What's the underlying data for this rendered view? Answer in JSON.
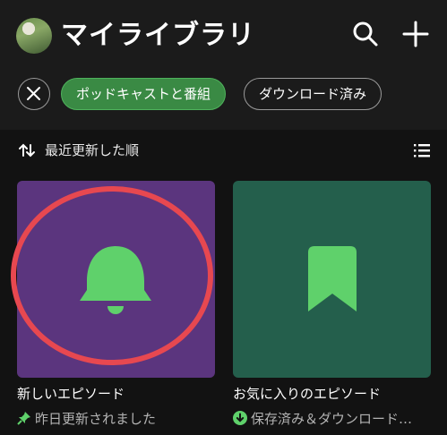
{
  "header": {
    "title": "マイライブラリ"
  },
  "filters": {
    "chips": [
      {
        "label": "ポッドキャストと番組",
        "active": true
      },
      {
        "label": "ダウンロード済み",
        "active": false
      }
    ]
  },
  "sort": {
    "label": "最近更新した順"
  },
  "cards": [
    {
      "title": "新しいエピソード",
      "subtitle": "昨日更新されました",
      "icon": "bell-icon",
      "status_icon": "pin-icon",
      "bg": "#5b357e"
    },
    {
      "title": "お気に入りのエピソード",
      "subtitle": "保存済み＆ダウンロード…",
      "icon": "bookmark-icon",
      "status_icon": "download-icon",
      "bg": "#245f4c"
    }
  ],
  "colors": {
    "accent_green": "#5fd16b",
    "highlight_ring": "#e74850"
  }
}
